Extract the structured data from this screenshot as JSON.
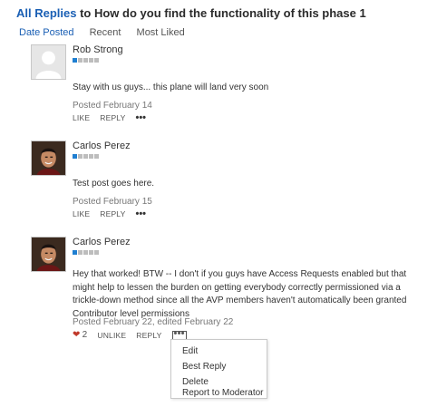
{
  "header": {
    "link": "All Replies",
    "title": "to How do you find the functionality of this phase 1"
  },
  "sort_tabs": [
    {
      "label": "Date Posted",
      "active": true
    },
    {
      "label": "Recent",
      "active": false
    },
    {
      "label": "Most Liked",
      "active": false
    }
  ],
  "posts": [
    {
      "author": "Rob Strong",
      "rank_level": 1,
      "rank_max": 5,
      "body": "Stay with us guys... this plane will land very soon",
      "posted": "Posted February 14",
      "like": "LIKE",
      "reply": "REPLY",
      "more": "•••"
    },
    {
      "author": "Carlos Perez",
      "rank_level": 1,
      "rank_max": 5,
      "body": "Test post goes here.",
      "posted": "Posted February 15",
      "like": "LIKE",
      "reply": "REPLY",
      "more": "•••"
    },
    {
      "author": "Carlos Perez",
      "rank_level": 1,
      "rank_max": 5,
      "body": "Hey that worked! BTW -- I don't if you guys have Access Requests enabled but that might help to lessen the burden on getting everybody correctly permissioned via a trickle-down method since all the AVP members haven't automatically been granted Contributor level permissions",
      "posted": "Posted February 22, edited February 22",
      "like_count": "2",
      "unlike": "UNLIKE",
      "reply": "REPLY",
      "more": "•••"
    }
  ],
  "context_menu": {
    "items": [
      "Edit",
      "Best Reply",
      "Delete",
      "Report to Moderator"
    ]
  },
  "colors": {
    "link": "#1a5fb4",
    "rank_on": "#1f7fd1",
    "heart": "#c0392b"
  }
}
